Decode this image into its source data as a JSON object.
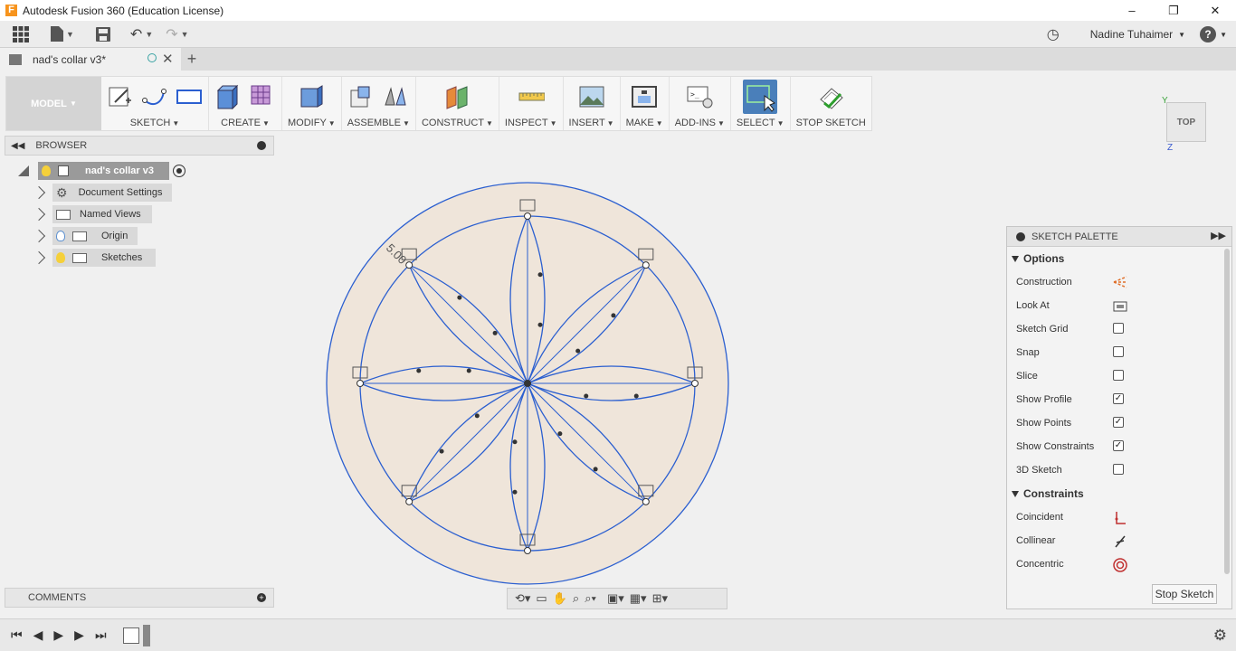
{
  "window": {
    "title": "Autodesk Fusion 360 (Education License)",
    "app_icon_letter": "F",
    "controls": [
      "–",
      "❐",
      "✕"
    ]
  },
  "quick_access": {
    "user": "Nadine Tuhaimer",
    "help": "?"
  },
  "document_tab": {
    "name": "nad's collar v3*"
  },
  "toolbar": {
    "workspace": "MODEL",
    "groups": [
      {
        "id": "sketch",
        "label": "SKETCH"
      },
      {
        "id": "create",
        "label": "CREATE"
      },
      {
        "id": "modify",
        "label": "MODIFY"
      },
      {
        "id": "assemble",
        "label": "ASSEMBLE"
      },
      {
        "id": "construct",
        "label": "CONSTRUCT"
      },
      {
        "id": "inspect",
        "label": "INSPECT"
      },
      {
        "id": "insert",
        "label": "INSERT"
      },
      {
        "id": "make",
        "label": "MAKE"
      },
      {
        "id": "addins",
        "label": "ADD-INS"
      },
      {
        "id": "select",
        "label": "SELECT"
      },
      {
        "id": "stop",
        "label": "STOP SKETCH"
      }
    ]
  },
  "browser": {
    "header": "BROWSER",
    "root": "nad's collar v3",
    "items": [
      {
        "label": "Document Settings"
      },
      {
        "label": "Named Views"
      },
      {
        "label": "Origin"
      },
      {
        "label": "Sketches"
      }
    ]
  },
  "comments": {
    "header": "COMMENTS"
  },
  "viewcube": {
    "face": "TOP",
    "axis_y": "Y",
    "axis_z": "Z"
  },
  "sketch": {
    "dimension_label": "5.00"
  },
  "palette": {
    "header": "SKETCH PALETTE",
    "options_label": "Options",
    "options": [
      {
        "label": "Construction",
        "type": "icon",
        "icon": "construction-icon"
      },
      {
        "label": "Look At",
        "type": "icon",
        "icon": "look-at-icon"
      },
      {
        "label": "Sketch Grid",
        "type": "checkbox",
        "checked": false
      },
      {
        "label": "Snap",
        "type": "checkbox",
        "checked": false
      },
      {
        "label": "Slice",
        "type": "checkbox",
        "checked": false
      },
      {
        "label": "Show Profile",
        "type": "checkbox",
        "checked": true
      },
      {
        "label": "Show Points",
        "type": "checkbox",
        "checked": true
      },
      {
        "label": "Show Constraints",
        "type": "checkbox",
        "checked": true
      },
      {
        "label": "3D Sketch",
        "type": "checkbox",
        "checked": false
      }
    ],
    "constraints_label": "Constraints",
    "constraints": [
      {
        "label": "Coincident",
        "icon": "coincident-icon"
      },
      {
        "label": "Collinear",
        "icon": "collinear-icon"
      },
      {
        "label": "Concentric",
        "icon": "concentric-icon"
      }
    ],
    "stop_button": "Stop Sketch"
  },
  "colors": {
    "sketch_line": "#2b5fd0",
    "profile_fill": "#efe5da",
    "select_active": "#4a7fba"
  }
}
